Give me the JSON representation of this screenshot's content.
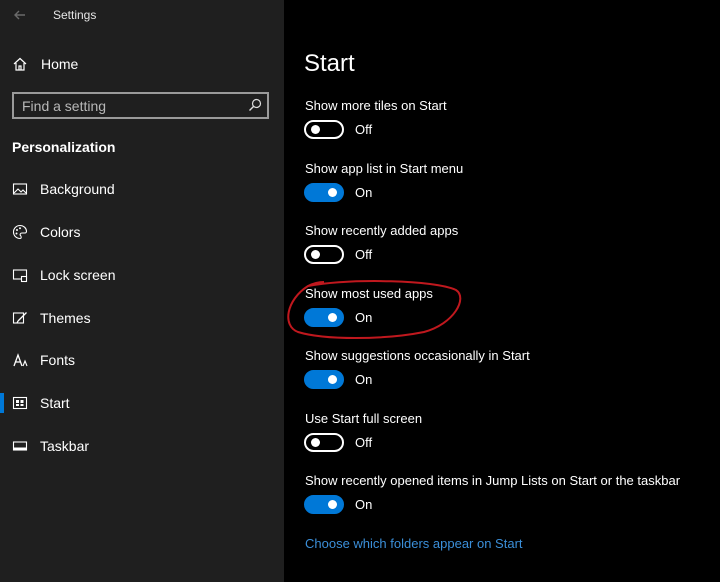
{
  "window": {
    "title": "Settings"
  },
  "sidebar": {
    "home_label": "Home",
    "search": {
      "placeholder": "Find a setting",
      "value": ""
    },
    "section_heading": "Personalization",
    "items": [
      {
        "label": "Background",
        "icon": "picture-icon",
        "selected": false
      },
      {
        "label": "Colors",
        "icon": "palette-icon",
        "selected": false
      },
      {
        "label": "Lock screen",
        "icon": "lock-screen-icon",
        "selected": false
      },
      {
        "label": "Themes",
        "icon": "themes-icon",
        "selected": false
      },
      {
        "label": "Fonts",
        "icon": "fonts-icon",
        "selected": false
      },
      {
        "label": "Start",
        "icon": "start-icon",
        "selected": true
      },
      {
        "label": "Taskbar",
        "icon": "taskbar-icon",
        "selected": false
      }
    ]
  },
  "main": {
    "title": "Start",
    "settings": [
      {
        "label": "Show more tiles on Start",
        "on": false,
        "state": "Off"
      },
      {
        "label": "Show app list in Start menu",
        "on": true,
        "state": "On"
      },
      {
        "label": "Show recently added apps",
        "on": false,
        "state": "Off"
      },
      {
        "label": "Show most used apps",
        "on": true,
        "state": "On"
      },
      {
        "label": "Show suggestions occasionally in Start",
        "on": true,
        "state": "On"
      },
      {
        "label": "Use Start full screen",
        "on": false,
        "state": "Off"
      },
      {
        "label": "Show recently opened items in Jump Lists on Start or the taskbar",
        "on": true,
        "state": "On"
      }
    ],
    "link": "Choose which folders appear on Start"
  },
  "colors": {
    "accent": "#0078d7",
    "link": "#3b8fd9",
    "annotation": "#c0181e"
  }
}
